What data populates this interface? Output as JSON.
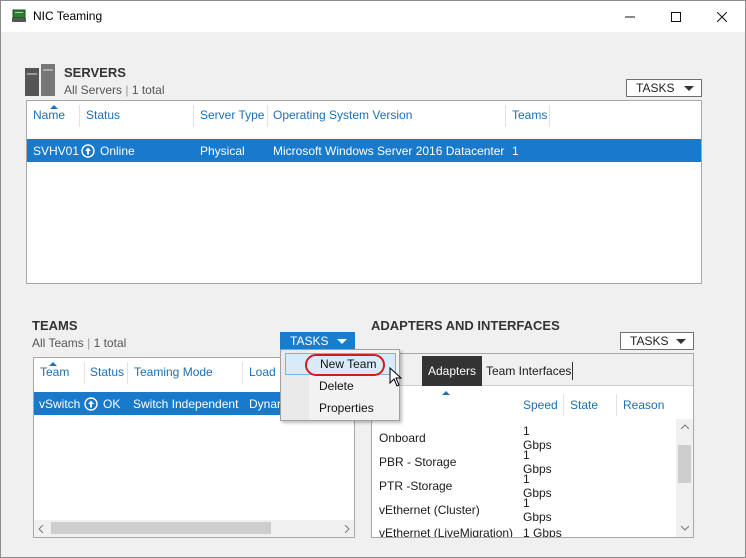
{
  "window": {
    "title": "NIC Teaming"
  },
  "servers": {
    "title": "SERVERS",
    "subtitle_left": "All Servers",
    "subtitle_right": "1 total",
    "tasks_label": "TASKS",
    "columns": [
      "Name",
      "Status",
      "Server Type",
      "Operating System Version",
      "Teams"
    ],
    "rows": [
      {
        "name": "SVHV01",
        "status": "Online",
        "server_type": "Physical",
        "os": "Microsoft Windows Server 2016 Datacenter",
        "teams": "1"
      }
    ]
  },
  "teams": {
    "title": "TEAMS",
    "subtitle_left": "All Teams",
    "subtitle_right": "1 total",
    "tasks_label": "TASKS",
    "columns": [
      "Team",
      "Status",
      "Teaming Mode",
      "Load"
    ],
    "rows": [
      {
        "team": "vSwitch",
        "status": "OK",
        "mode": "Switch Independent",
        "load": "Dynar"
      }
    ]
  },
  "tasks_menu": {
    "items": [
      "New Team",
      "Delete",
      "Properties"
    ]
  },
  "adapters": {
    "title": "ADAPTERS AND INTERFACES",
    "tasks_label": "TASKS",
    "tabs": [
      "Adapters",
      "Team Interfaces"
    ],
    "columns": [
      "Speed",
      "State",
      "Reason"
    ],
    "rows": [
      {
        "name": "Onboard",
        "speed": "1 Gbps"
      },
      {
        "name": "PBR - Storage",
        "speed": "1 Gbps"
      },
      {
        "name": "PTR -Storage",
        "speed": "1 Gbps"
      },
      {
        "name": "vEthernet (Cluster)",
        "speed": "1 Gbps"
      },
      {
        "name": "vEthernet (LiveMigration)",
        "speed": "1 Gbps"
      }
    ]
  },
  "colors": {
    "accent": "#1979ca",
    "highlight": "#d61a1a"
  }
}
